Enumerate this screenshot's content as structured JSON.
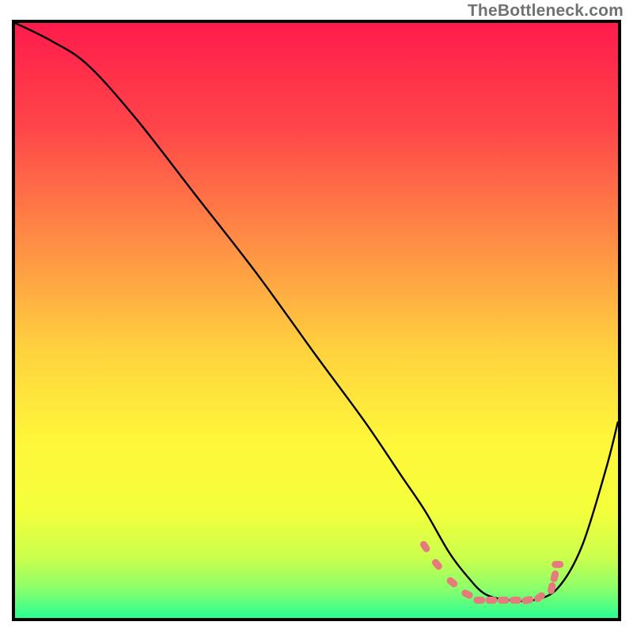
{
  "watermark": "TheBottleneck.com",
  "chart_data": {
    "type": "line",
    "title": "",
    "xlabel": "",
    "ylabel": "",
    "xlim": [
      0,
      100
    ],
    "ylim": [
      0,
      100
    ],
    "grid": false,
    "legend": false,
    "background_gradient": {
      "stops": [
        {
          "pos": 0.0,
          "color": "#ff1b4c"
        },
        {
          "pos": 0.18,
          "color": "#ff4749"
        },
        {
          "pos": 0.38,
          "color": "#ff9245"
        },
        {
          "pos": 0.55,
          "color": "#ffd23e"
        },
        {
          "pos": 0.7,
          "color": "#fff63a"
        },
        {
          "pos": 0.82,
          "color": "#f4ff3b"
        },
        {
          "pos": 0.9,
          "color": "#c9ff4d"
        },
        {
          "pos": 0.95,
          "color": "#8cff6a"
        },
        {
          "pos": 1.0,
          "color": "#29ff95"
        }
      ]
    },
    "series": [
      {
        "name": "bottleneck-curve",
        "color": "#000000",
        "x": [
          0,
          6,
          12,
          20,
          30,
          40,
          50,
          58,
          64,
          68,
          72,
          75,
          78,
          82,
          86,
          90,
          94,
          98,
          100
        ],
        "y": [
          100,
          97,
          93,
          84,
          71,
          58,
          44,
          33,
          24,
          18,
          11,
          7,
          4,
          3,
          3,
          5,
          12,
          25,
          33
        ]
      }
    ],
    "markers": {
      "name": "optimal-range",
      "color": "#e67b7d",
      "shape": "rounded-pill",
      "x": [
        68,
        70,
        72.5,
        75,
        77,
        79,
        81,
        83,
        85,
        87,
        89,
        89.5,
        90
      ],
      "y": [
        12,
        9,
        6,
        4,
        3,
        3,
        3,
        3,
        3,
        3.5,
        5,
        7,
        9
      ]
    }
  }
}
